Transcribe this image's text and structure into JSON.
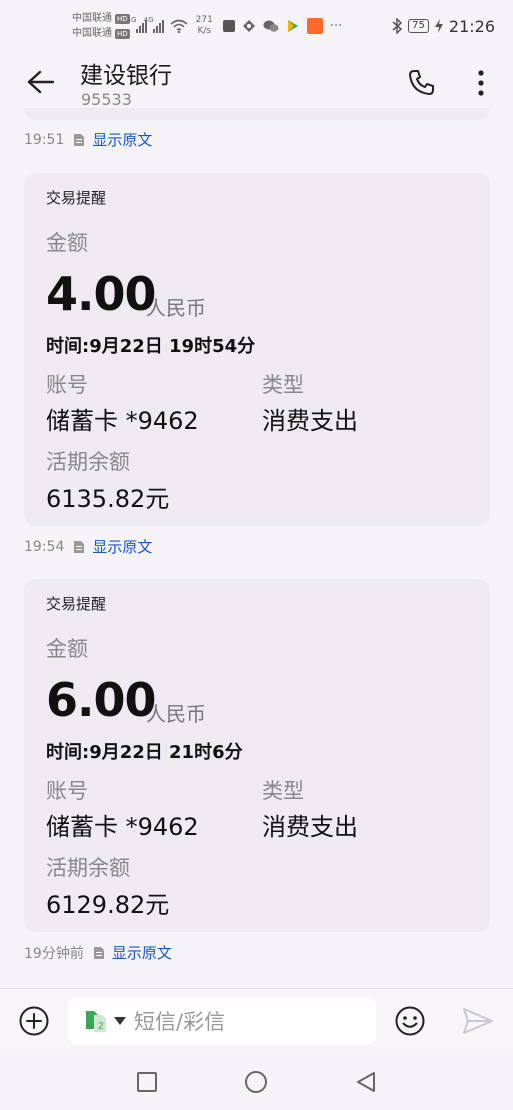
{
  "status_bar": {
    "carrier1": "中国联通",
    "carrier2": "中国联通",
    "hd_badge": "HD",
    "network_type": "4G",
    "net_speed_value": "271",
    "net_speed_unit": "K/s",
    "battery": "75",
    "time": "21:26",
    "more_dots": "···"
  },
  "header": {
    "contact_name": "建设银行",
    "contact_number": "95533"
  },
  "messages": [
    {
      "meta_time": "19:51",
      "meta_link": "显示原文"
    },
    {
      "card_title": "交易提醒",
      "amount_label": "金额",
      "amount": "4.00",
      "currency": "人民币",
      "time_line": "时间:9月22日 19时54分",
      "account_label": "账号",
      "account_value": "储蓄卡 *9462",
      "type_label": "类型",
      "type_value": "消费支出",
      "balance_label": "活期余额",
      "balance_value": "6135.82元",
      "meta_time": "19:54",
      "meta_link": "显示原文"
    },
    {
      "card_title": "交易提醒",
      "amount_label": "金额",
      "amount": "6.00",
      "currency": "人民币",
      "time_line": "时间:9月22日 21时6分",
      "account_label": "账号",
      "account_value": "储蓄卡 *9462",
      "type_label": "类型",
      "type_value": "消费支出",
      "balance_label": "活期余额",
      "balance_value": "6129.82元",
      "meta_time": "19分钟前",
      "meta_link": "显示原文"
    }
  ],
  "input_bar": {
    "placeholder": "短信/彩信",
    "sim_slot": "2"
  },
  "colors": {
    "link": "#1a56c4",
    "card_bg": "#efe9f2",
    "page_bg": "#f6f3f8"
  }
}
